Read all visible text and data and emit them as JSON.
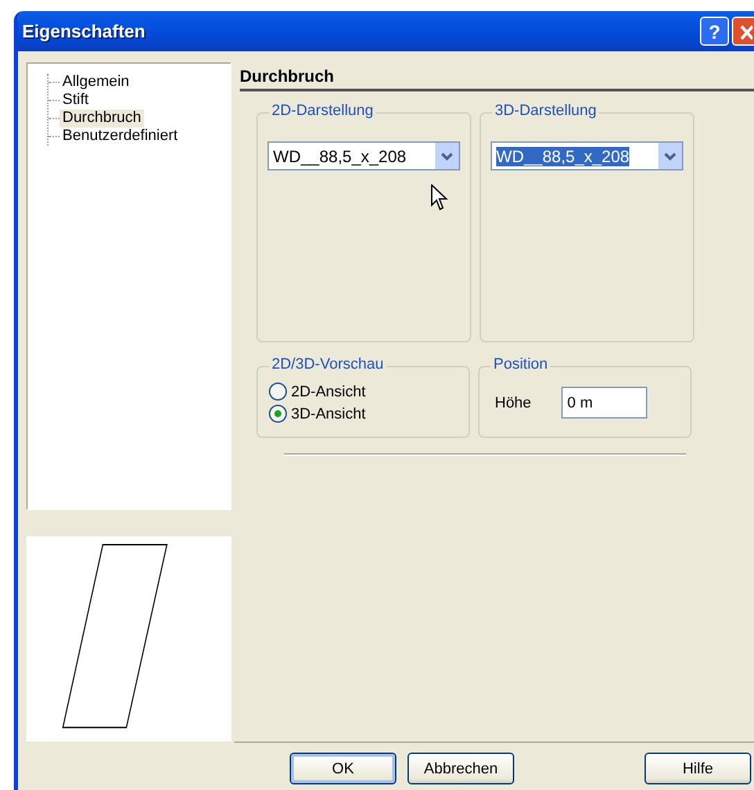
{
  "window": {
    "title": "Eigenschaften",
    "help_button": "?"
  },
  "tree": {
    "items": [
      {
        "label": "Allgemein",
        "selected": false
      },
      {
        "label": "Stift",
        "selected": false
      },
      {
        "label": "Durchbruch",
        "selected": true
      },
      {
        "label": "Benutzerdefiniert",
        "selected": false
      }
    ]
  },
  "page": {
    "heading": "Durchbruch",
    "display_groups": [
      {
        "title": "2D-Darstellung",
        "value": "WD__88,5_x_208",
        "text_selected": false
      },
      {
        "title": "3D-Darstellung",
        "value": "WD__88,5_x_208",
        "text_selected": true
      }
    ],
    "preview": {
      "title": "2D/3D-Vorschau",
      "options": [
        {
          "label": "2D-Ansicht",
          "selected": false
        },
        {
          "label": "3D-Ansicht",
          "selected": true
        }
      ]
    },
    "position": {
      "title": "Position",
      "label": "Höhe",
      "value": "0 m"
    }
  },
  "buttons": [
    {
      "label": "OK",
      "default": true
    },
    {
      "label": "Abbrechen",
      "default": false
    },
    {
      "label": "Hilfe",
      "default": false
    }
  ]
}
